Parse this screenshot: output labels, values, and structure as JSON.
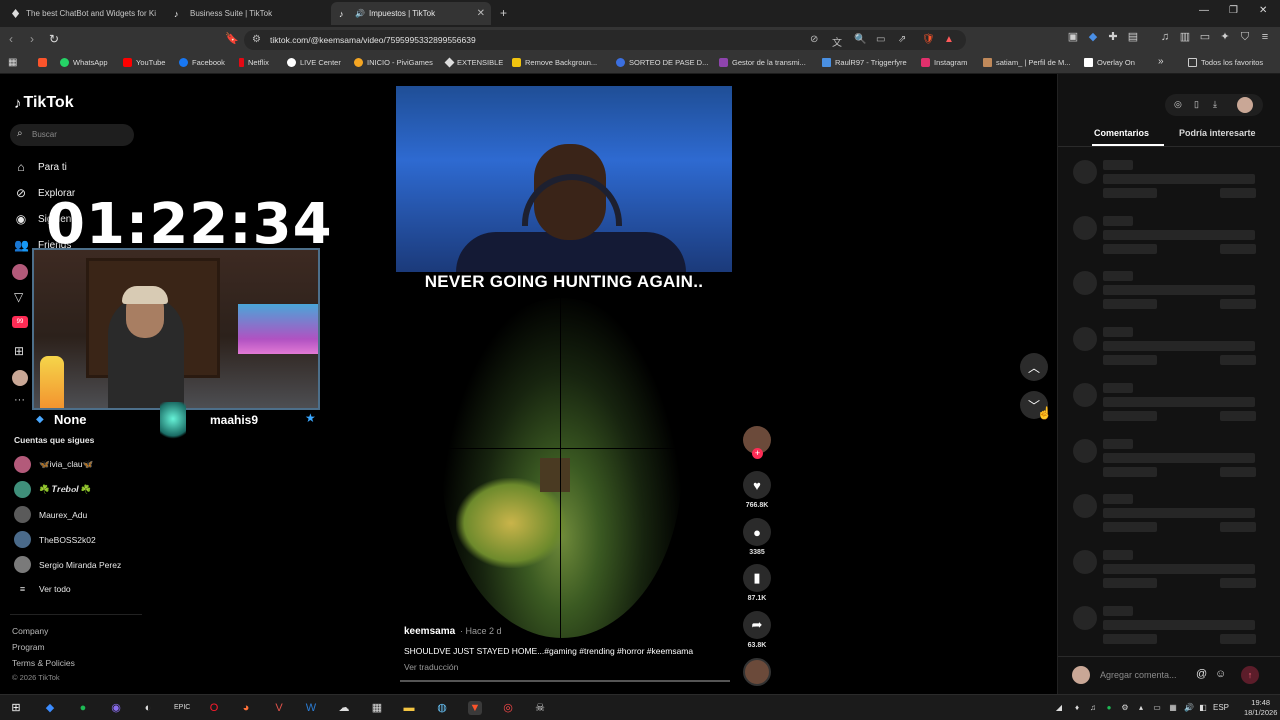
{
  "browser": {
    "tabs": [
      {
        "label": "The best ChatBot and Widgets for Ki",
        "active": false
      },
      {
        "label": "Business Suite | TikTok",
        "active": false
      },
      {
        "label": "Impuestos | TikTok",
        "active": true
      }
    ],
    "new_tab": "+",
    "url": "tiktok.com/@keemsama/video/7595995332899556639",
    "bookmarks": [
      {
        "label": "WhatsApp",
        "color": "#25d366"
      },
      {
        "label": "YouTube",
        "color": "#ff0000"
      },
      {
        "label": "Facebook",
        "color": "#1877f2"
      },
      {
        "label": "Netflix",
        "color": "#e50914"
      },
      {
        "label": "LIVE Center",
        "color": "#ffffff"
      },
      {
        "label": "INICIO - PiviGames",
        "color": "#f5a623"
      },
      {
        "label": "EXTENSIBLE",
        "color": "#dddddd"
      },
      {
        "label": "Remove Backgroun...",
        "color": "#f1c40f"
      },
      {
        "label": "SORTEO DE PASE D...",
        "color": "#3b6fe0"
      },
      {
        "label": "Gestor de la transmi...",
        "color": "#8e44ad"
      },
      {
        "label": "RaulR97 - Triggerfyre",
        "color": "#4a90e2"
      },
      {
        "label": "Instagram",
        "color": "#e1306c"
      },
      {
        "label": "satiam_ | Perfil de M...",
        "color": "#c0895a"
      },
      {
        "label": "Overlay On",
        "color": "#ffffff"
      }
    ],
    "bookmarks_more": "»",
    "all_favorites": "Todos los favoritos"
  },
  "sidebar": {
    "logo": "TikTok",
    "search_placeholder": "Buscar",
    "nav": [
      {
        "label": "Para ti",
        "icon": "home-icon"
      },
      {
        "label": "Explorar",
        "icon": "compass-icon"
      },
      {
        "label": "Siguiendo",
        "icon": "following-icon"
      },
      {
        "label": "Friends",
        "icon": "friends-icon"
      }
    ],
    "following_title": "Cuentas que sigues",
    "following": [
      {
        "name": "🦋ivia_clau🦋",
        "color": "#b35a7a"
      },
      {
        "name": "☘️ 𝑻𝒓𝒆𝒃𝒐𝒍 ☘️",
        "color": "#3f8f7a"
      },
      {
        "name": "Maurex_Adu",
        "color": "#5a5a5a"
      },
      {
        "name": "TheBOSS2k02",
        "color": "#4a6a8a"
      },
      {
        "name": "Sergio Miranda Perez",
        "color": "#7a7a7a"
      }
    ],
    "see_all": "Ver todo",
    "footer": [
      "Company",
      "Program",
      "Terms & Policies",
      "© 2026 TikTok"
    ]
  },
  "stream_overlay": {
    "timer": "01:22:34",
    "label_left": "None",
    "username": "maahis9"
  },
  "video": {
    "title_overlay": "NEVER GOING HUNTING AGAIN..",
    "author": "keemsama",
    "posted": "· Hace 2 d",
    "caption": "SHOULDVE JUST STAYED HOME...#gaming #trending #horror #keemsama",
    "translate": "Ver traducción",
    "likes": "766.8K",
    "comments": "3385",
    "saves": "87.1K",
    "shares": "63.8K",
    "follow_plus": "+"
  },
  "comments_panel": {
    "tabs": [
      "Comentarios",
      "Podría interesarte"
    ],
    "input_placeholder": "Agregar comenta...",
    "skeleton_rows": 9
  },
  "taskbar": {
    "lang": "ESP",
    "time": "19:48",
    "date": "18/1/2026"
  }
}
